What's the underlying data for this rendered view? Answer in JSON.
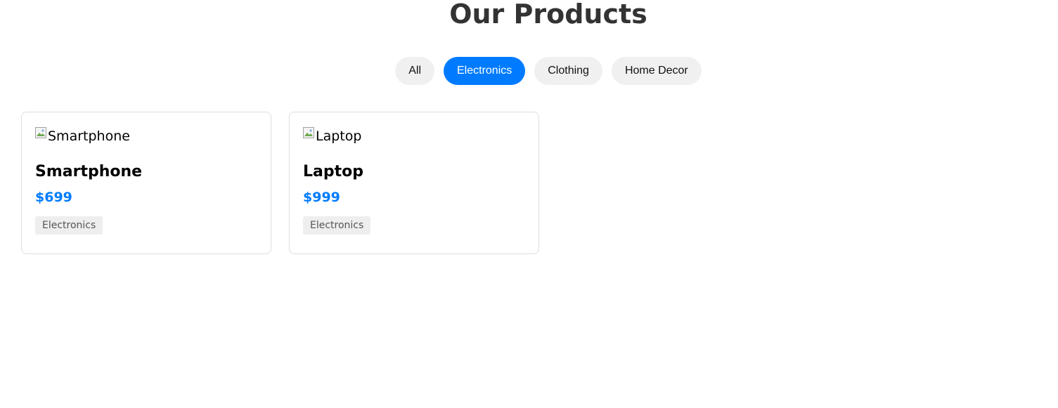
{
  "header": {
    "title": "Our Products"
  },
  "filters": [
    {
      "label": "All",
      "active": false
    },
    {
      "label": "Electronics",
      "active": true
    },
    {
      "label": "Clothing",
      "active": false
    },
    {
      "label": "Home Decor",
      "active": false
    }
  ],
  "products": [
    {
      "image_alt": "Smartphone",
      "name": "Smartphone",
      "price": "$699",
      "category": "Electronics"
    },
    {
      "image_alt": "Laptop",
      "name": "Laptop",
      "price": "$999",
      "category": "Electronics"
    }
  ],
  "colors": {
    "accent": "#007bff",
    "title": "#333333",
    "chip_bg": "#f0f0f0",
    "badge_bg": "#eeeeee"
  }
}
